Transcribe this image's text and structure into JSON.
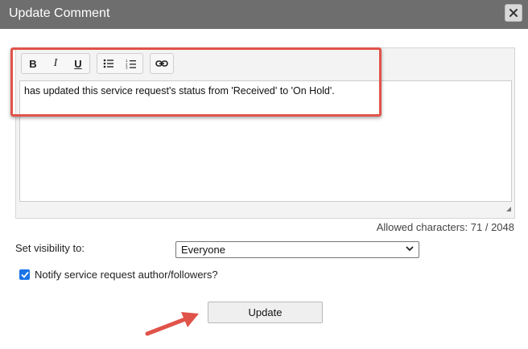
{
  "dialog": {
    "title": "Update Comment",
    "close_icon": "close-icon"
  },
  "toolbar": {
    "bold_label": "B",
    "italic_label": "I",
    "underline_label": "U",
    "bullet_list_icon": "bullet-list-icon",
    "numbered_list_icon": "numbered-list-icon",
    "link_icon": "link-icon"
  },
  "editor": {
    "content": "has updated this service request's status from 'Received' to 'On Hold'."
  },
  "counter": {
    "text": "Allowed characters: 71 / 2048"
  },
  "visibility": {
    "label": "Set visibility to:",
    "selected": "Everyone"
  },
  "notify": {
    "label": "Notify service request author/followers?",
    "checked": true
  },
  "actions": {
    "update_label": "Update"
  },
  "annotations": {
    "highlight_color": "#e0534a",
    "arrow_color": "#e0534a"
  }
}
